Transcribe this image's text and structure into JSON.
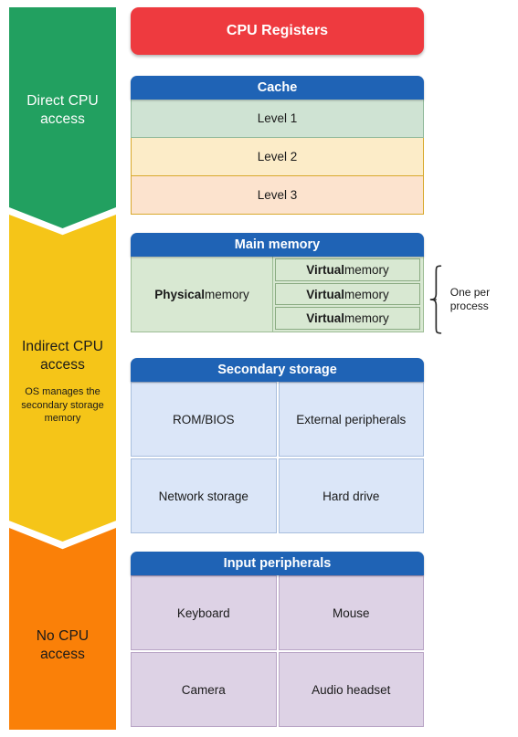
{
  "access_levels": [
    {
      "id": "direct",
      "title": "Direct CPU access",
      "subtitle": "",
      "color": "#22a060",
      "text_color": "#ffffff"
    },
    {
      "id": "indirect",
      "title": "Indirect CPU access",
      "subtitle": "OS manages the secondary storage memory",
      "color": "#f5c518",
      "text_color": "#1a1a1a"
    },
    {
      "id": "none",
      "title": "No CPU access",
      "subtitle": "",
      "color": "#fa8008",
      "text_color": "#1a1a1a"
    }
  ],
  "blocks": {
    "registers": {
      "label": "CPU Registers",
      "color": "#ee3a3f"
    },
    "cache": {
      "header": "Cache",
      "header_color": "#1f63b5",
      "rows": [
        {
          "label": "Level 1",
          "color": "#cfe3d3"
        },
        {
          "label": "Level 2",
          "color": "#fcecc8"
        },
        {
          "label": "Level 3",
          "color": "#fce3ce"
        }
      ]
    },
    "main_memory": {
      "header": "Main memory",
      "header_color": "#1f63b5",
      "physical": {
        "bold": "Physical",
        "rest": " memory"
      },
      "virtual": [
        {
          "bold": "Virtual",
          "rest": " memory"
        },
        {
          "bold": "Virtual",
          "rest": " memory"
        },
        {
          "bold": "Virtual",
          "rest": " memory"
        }
      ],
      "annotation": "One per process",
      "cell_color": "#d8e8d2"
    },
    "secondary_storage": {
      "header": "Secondary storage",
      "header_color": "#1f63b5",
      "cells": [
        "ROM/BIOS",
        "External peripherals",
        "Network storage",
        "Hard drive"
      ],
      "cell_color": "#dbe6f8"
    },
    "input_peripherals": {
      "header": "Input peripherals",
      "header_color": "#1f63b5",
      "cells": [
        "Keyboard",
        "Mouse",
        "Camera",
        "Audio headset"
      ],
      "cell_color": "#ddd2e5"
    }
  }
}
